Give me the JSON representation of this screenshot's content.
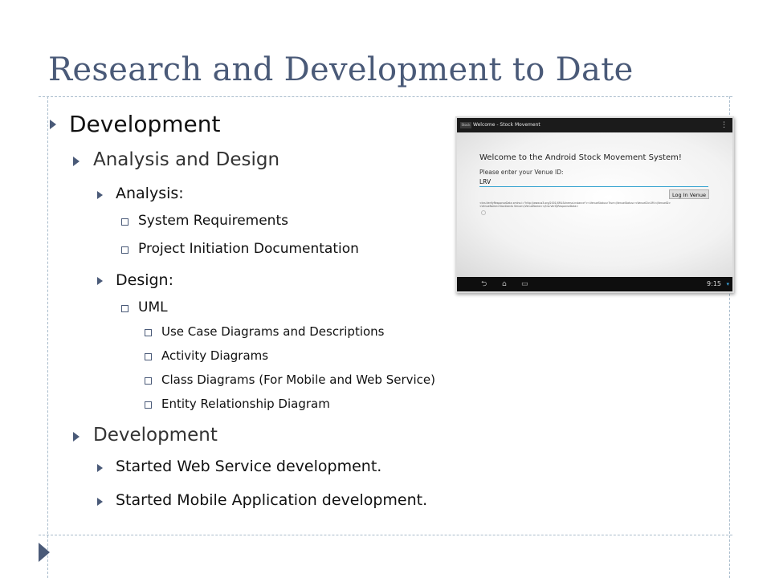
{
  "slide": {
    "title": "Research and Development to Date"
  },
  "outline": [
    {
      "level": 1,
      "bullet": "triangle",
      "text": "Development"
    },
    {
      "level": 2,
      "bullet": "triangle",
      "text": "Analysis and Design"
    },
    {
      "level": 3,
      "bullet": "triangle",
      "text": "Analysis:"
    },
    {
      "level": 4,
      "bullet": "square",
      "text": "System Requirements"
    },
    {
      "level": 4,
      "bullet": "square",
      "text": "Project Initiation Documentation"
    },
    {
      "level": 3,
      "bullet": "triangle",
      "text": "Design:"
    },
    {
      "level": 4,
      "bullet": "square",
      "text": "UML"
    },
    {
      "level": 5,
      "bullet": "square",
      "text": "Use Case Diagrams and Descriptions"
    },
    {
      "level": 5,
      "bullet": "square",
      "text": "Activity Diagrams"
    },
    {
      "level": 5,
      "bullet": "square",
      "text": "Class Diagrams (For Mobile and Web Service)"
    },
    {
      "level": 5,
      "bullet": "square",
      "text": "Entity Relationship Diagram"
    },
    {
      "level": 2,
      "bullet": "triangle",
      "text": "Development"
    },
    {
      "level": 3,
      "bullet": "triangle",
      "text": "Started Web Service development."
    },
    {
      "level": 3,
      "bullet": "triangle",
      "text": "Started Mobile Application development."
    }
  ],
  "tablet": {
    "app_icon_label": "Stock",
    "app_title": "Welcome - Stock Movement",
    "welcome_text": "Welcome to the Android Stock Movement System!",
    "prompt_text": "Please enter your Venue ID:",
    "input_value": "LRV",
    "login_button": "Log In Venue",
    "xml_response": "<tns:VerifyResponseData xmlns:i=\"http://www.w3.org/2001/XMLSchema-instance\"><VenueStatus>True</VenueStatus><VenueID>LRV</VenueID><VenueName>Stocklands Venue</VenueName></tns:VerifyResponseData>",
    "clock": "9:15",
    "colors": {
      "accent": "#36a3d0",
      "status_bar": "#1b1b1b",
      "nav_bar": "#0e0e0e"
    }
  },
  "theme": {
    "title_color": "#4a5a78",
    "bullet_color": "#4a5a78",
    "divider_color": "#a9bccc"
  }
}
